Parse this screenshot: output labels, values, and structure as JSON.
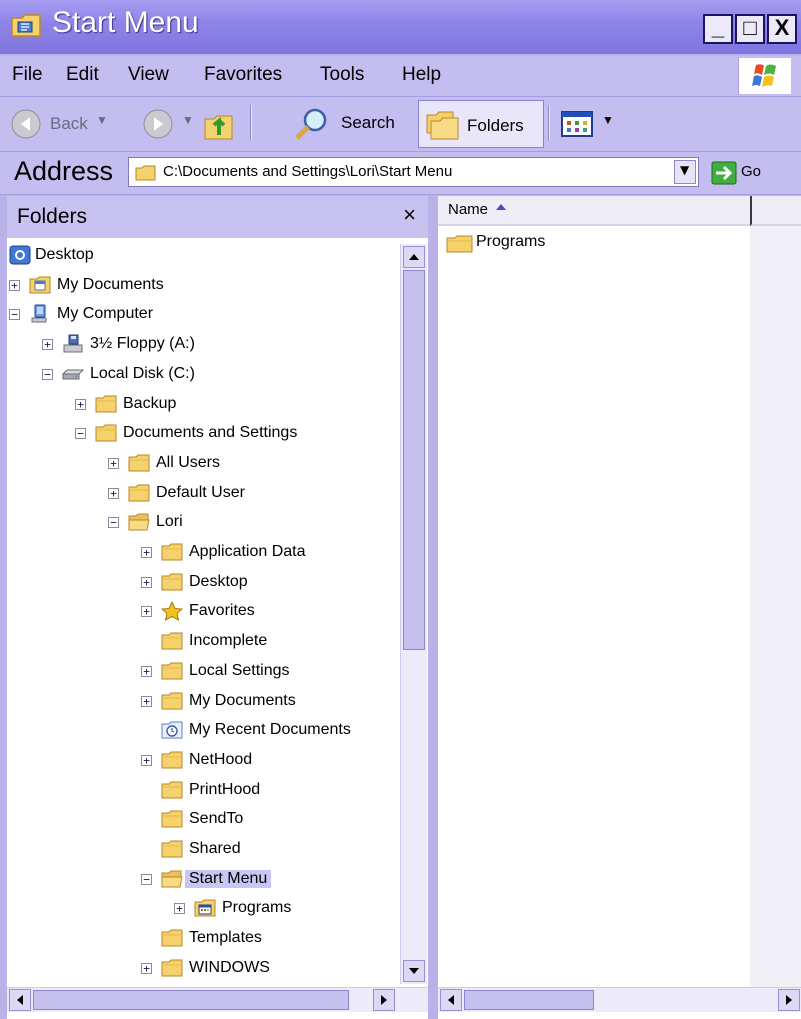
{
  "window": {
    "title": "Start Menu",
    "controls": {
      "minimize": "_",
      "maximize": "□",
      "close": "X"
    }
  },
  "menu": [
    "File",
    "Edit",
    "View",
    "Favorites",
    "Tools",
    "Help"
  ],
  "toolbar": {
    "back_label": "Back",
    "search_label": "Search",
    "folders_label": "Folders"
  },
  "address": {
    "label": "Address",
    "path": "C:\\Documents and Settings\\Lori\\Start Menu",
    "go_label": "Go"
  },
  "folders_pane": {
    "title": "Folders",
    "close_glyph": "×"
  },
  "tree": [
    {
      "label": "Desktop",
      "depth": 0,
      "expander": "",
      "icon": "desktop-icon"
    },
    {
      "label": "My Documents",
      "depth": 1,
      "expander": "+",
      "icon": "my-documents-icon"
    },
    {
      "label": "My Computer",
      "depth": 1,
      "expander": "-",
      "icon": "my-computer-icon"
    },
    {
      "label": "3½ Floppy (A:)",
      "depth": 2,
      "expander": "+",
      "icon": "floppy-drive-icon"
    },
    {
      "label": "Local Disk (C:)",
      "depth": 2,
      "expander": "-",
      "icon": "hard-disk-icon"
    },
    {
      "label": "Backup",
      "depth": 3,
      "expander": "+",
      "icon": "folder-icon"
    },
    {
      "label": "Documents and Settings",
      "depth": 3,
      "expander": "-",
      "icon": "folder-icon"
    },
    {
      "label": "All Users",
      "depth": 4,
      "expander": "+",
      "icon": "folder-icon"
    },
    {
      "label": "Default User",
      "depth": 4,
      "expander": "+",
      "icon": "folder-icon"
    },
    {
      "label": "Lori",
      "depth": 4,
      "expander": "-",
      "icon": "folder-open-icon"
    },
    {
      "label": "Application Data",
      "depth": 5,
      "expander": "+",
      "icon": "folder-icon"
    },
    {
      "label": "Desktop",
      "depth": 5,
      "expander": "+",
      "icon": "folder-icon"
    },
    {
      "label": "Favorites",
      "depth": 5,
      "expander": "+",
      "icon": "favorites-star-icon"
    },
    {
      "label": "Incomplete",
      "depth": 5,
      "expander": "",
      "icon": "folder-icon"
    },
    {
      "label": "Local Settings",
      "depth": 5,
      "expander": "+",
      "icon": "folder-icon"
    },
    {
      "label": "My Documents",
      "depth": 5,
      "expander": "+",
      "icon": "folder-icon"
    },
    {
      "label": "My Recent Documents",
      "depth": 5,
      "expander": "",
      "icon": "recent-documents-icon"
    },
    {
      "label": "NetHood",
      "depth": 5,
      "expander": "+",
      "icon": "folder-icon"
    },
    {
      "label": "PrintHood",
      "depth": 5,
      "expander": "",
      "icon": "folder-icon"
    },
    {
      "label": "SendTo",
      "depth": 5,
      "expander": "",
      "icon": "folder-icon"
    },
    {
      "label": "Shared",
      "depth": 5,
      "expander": "",
      "icon": "folder-icon"
    },
    {
      "label": "Start Menu",
      "depth": 5,
      "expander": "-",
      "icon": "folder-open-icon",
      "selected": true
    },
    {
      "label": "Programs",
      "depth": 6,
      "expander": "+",
      "icon": "programs-folder-icon"
    },
    {
      "label": "Templates",
      "depth": 5,
      "expander": "",
      "icon": "folder-icon"
    },
    {
      "label": "WINDOWS",
      "depth": 5,
      "expander": "+",
      "icon": "folder-icon"
    }
  ],
  "content": {
    "column_header": "Name",
    "items": [
      {
        "label": "Programs",
        "icon": "folder-icon"
      }
    ]
  },
  "colors": {
    "title_gradient_start": "#a79ef2",
    "chrome": "#c4bdf0",
    "selection": "#c8c6f3",
    "folder_yellow": "#f5d26b"
  }
}
